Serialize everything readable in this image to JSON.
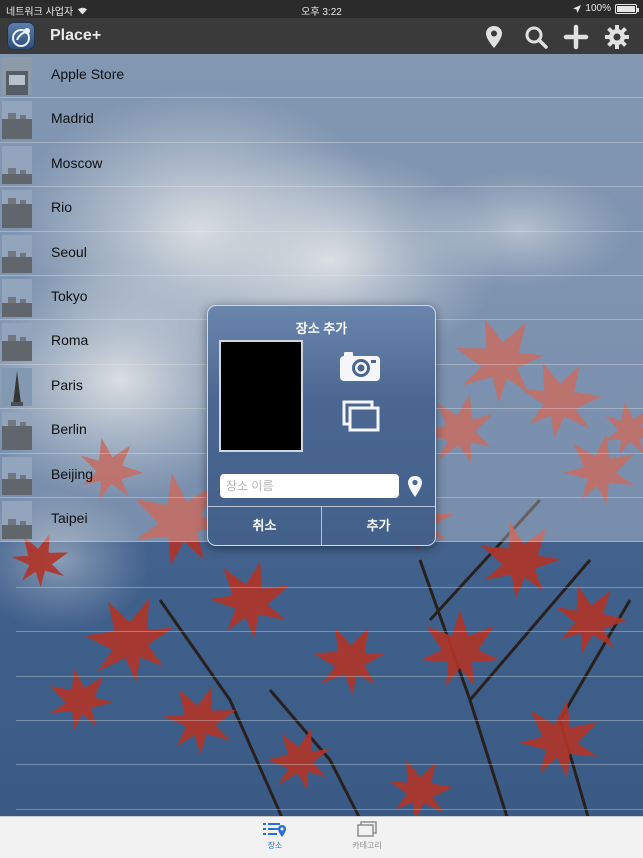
{
  "status_bar": {
    "carrier": "네트워크 사업자",
    "time": "오후 3:22",
    "battery": "100%"
  },
  "nav": {
    "title": "Place+",
    "icons": [
      "location-pin-icon",
      "search-icon",
      "add-icon",
      "gear-icon"
    ]
  },
  "places": [
    {
      "name": "Apple Store",
      "thumb": "store"
    },
    {
      "name": "Madrid",
      "thumb": "city"
    },
    {
      "name": "Moscow",
      "thumb": "city"
    },
    {
      "name": "Rio",
      "thumb": "city"
    },
    {
      "name": "Seoul",
      "thumb": "city"
    },
    {
      "name": "Tokyo",
      "thumb": "city"
    },
    {
      "name": "Roma",
      "thumb": "city"
    },
    {
      "name": "Paris",
      "thumb": "tower"
    },
    {
      "name": "Berlin",
      "thumb": "city"
    },
    {
      "name": "Beijing",
      "thumb": "city"
    },
    {
      "name": "Taipei",
      "thumb": "city"
    }
  ],
  "dialog": {
    "title": "장소 추가",
    "name_placeholder": "장소 이름",
    "cancel_label": "취소",
    "add_label": "추가"
  },
  "tabs": [
    {
      "label": "장소",
      "icon": "place-list-icon",
      "active": true
    },
    {
      "label": "카테고리",
      "icon": "category-icon",
      "active": false
    }
  ],
  "colors": {
    "active_tab": "#2b6fd6",
    "inactive_tab": "#8e8e8e",
    "nav_bg": "#3a3a3a"
  }
}
